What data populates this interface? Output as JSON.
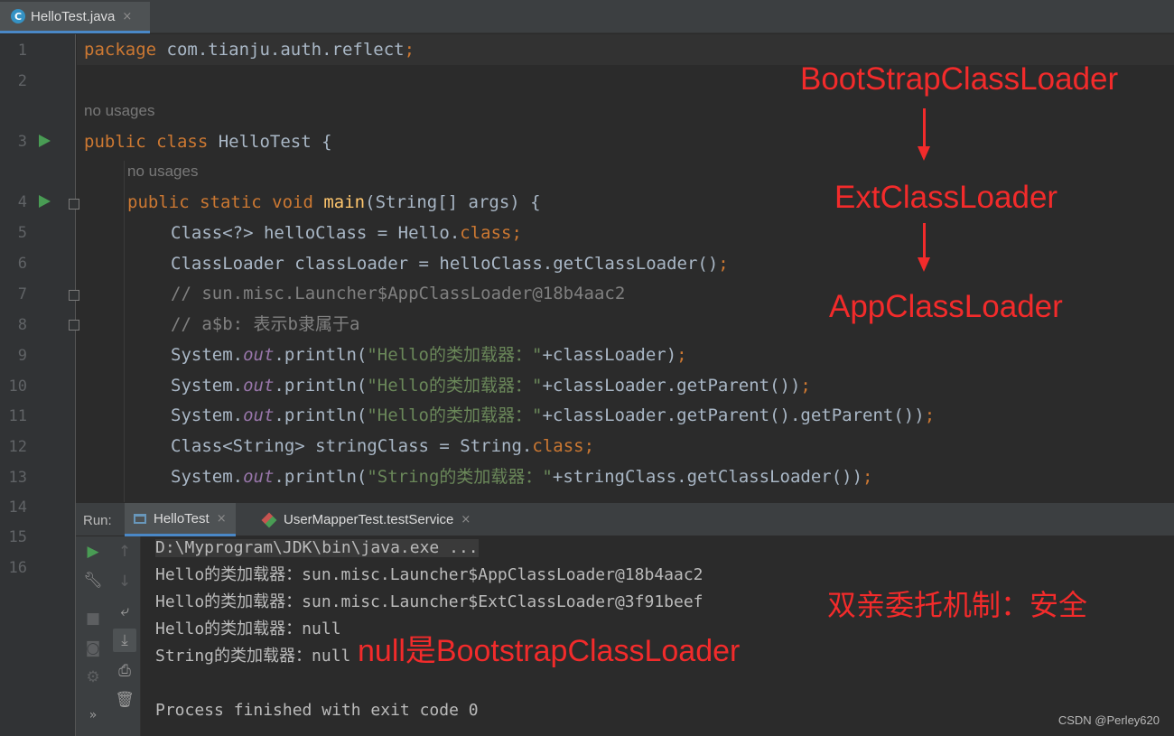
{
  "editor_tab": {
    "icon_letter": "C",
    "label": "HelloTest.java",
    "close": "×"
  },
  "gutter": {
    "line_numbers": [
      "1",
      "2",
      "3",
      "4",
      "5",
      "6",
      "7",
      "8",
      "9",
      "10",
      "11",
      "12",
      "13",
      "14",
      "15",
      "16"
    ]
  },
  "code": {
    "usage_hint": "no usages",
    "line1": {
      "kw": "package",
      "rest": " com.tianju.auth.reflect",
      "semi": ";"
    },
    "line3": {
      "kw1": "public",
      "kw2": "class",
      "name": " HelloTest {"
    },
    "line4": {
      "kw": "public static void",
      "fn": "main",
      "rest": "(String[] args) {"
    },
    "line5": {
      "a": "Class<?> helloClass = Hello.",
      "kw": "class",
      "semi": ";"
    },
    "line6": {
      "a": "ClassLoader classLoader = helloClass.getClassLoader()",
      "semi": ";"
    },
    "line7": "// sun.misc.Launcher$AppClassLoader@18b4aac2",
    "line8": "// a$b: 表示b隶属于a",
    "line9": {
      "a": "System.",
      "out": "out",
      "b": ".println(",
      "str": "\"Hello的类加载器：\"",
      "c": "+classLoader)",
      "semi": ";"
    },
    "line10": {
      "a": "System.",
      "out": "out",
      "b": ".println(",
      "str": "\"Hello的类加载器：\"",
      "c": "+classLoader.getParent())",
      "semi": ";"
    },
    "line11": {
      "a": "System.",
      "out": "out",
      "b": ".println(",
      "str": "\"Hello的类加载器：\"",
      "c": "+classLoader.getParent().getParent())",
      "semi": ";"
    },
    "line12": {
      "a": "Class<String> stringClass = String.",
      "kw": "class",
      "semi": ";"
    },
    "line13": {
      "a": "System.",
      "out": "out",
      "b": ".println(",
      "str": "\"String的类加载器：\"",
      "c": "+stringClass.getClassLoader())",
      "semi": ";"
    }
  },
  "run_panel": {
    "label": "Run:",
    "tabs": [
      {
        "label": "HelloTest",
        "close": "×"
      },
      {
        "label": "UserMapperTest.testService",
        "close": "×"
      }
    ],
    "side_icons": [
      "rerun-icon",
      "wrench-icon",
      "stop-icon",
      "camera-icon",
      "settings-icon",
      "more-icon",
      "up-icon",
      "down-icon",
      "soft-wrap-icon",
      "scroll-end-icon",
      "print-icon",
      "trash-icon"
    ],
    "more_glyph": "»",
    "output": [
      "D:\\Myprogram\\JDK\\bin\\java.exe ...",
      "Hello的类加载器：sun.misc.Launcher$AppClassLoader@18b4aac2",
      "Hello的类加载器：sun.misc.Launcher$ExtClassLoader@3f91beef",
      "Hello的类加载器：null",
      "String的类加载器：null",
      "",
      "Process finished with exit code 0"
    ]
  },
  "annotations": {
    "loader1": "BootStrapClassLoader",
    "loader2": "ExtClassLoader",
    "loader3": "AppClassLoader",
    "parent_delegation": "双亲委托机制：安全",
    "null_note": "null是BootstrapClassLoader",
    "color": "#f22b2b"
  },
  "watermark": "CSDN @Perley620"
}
